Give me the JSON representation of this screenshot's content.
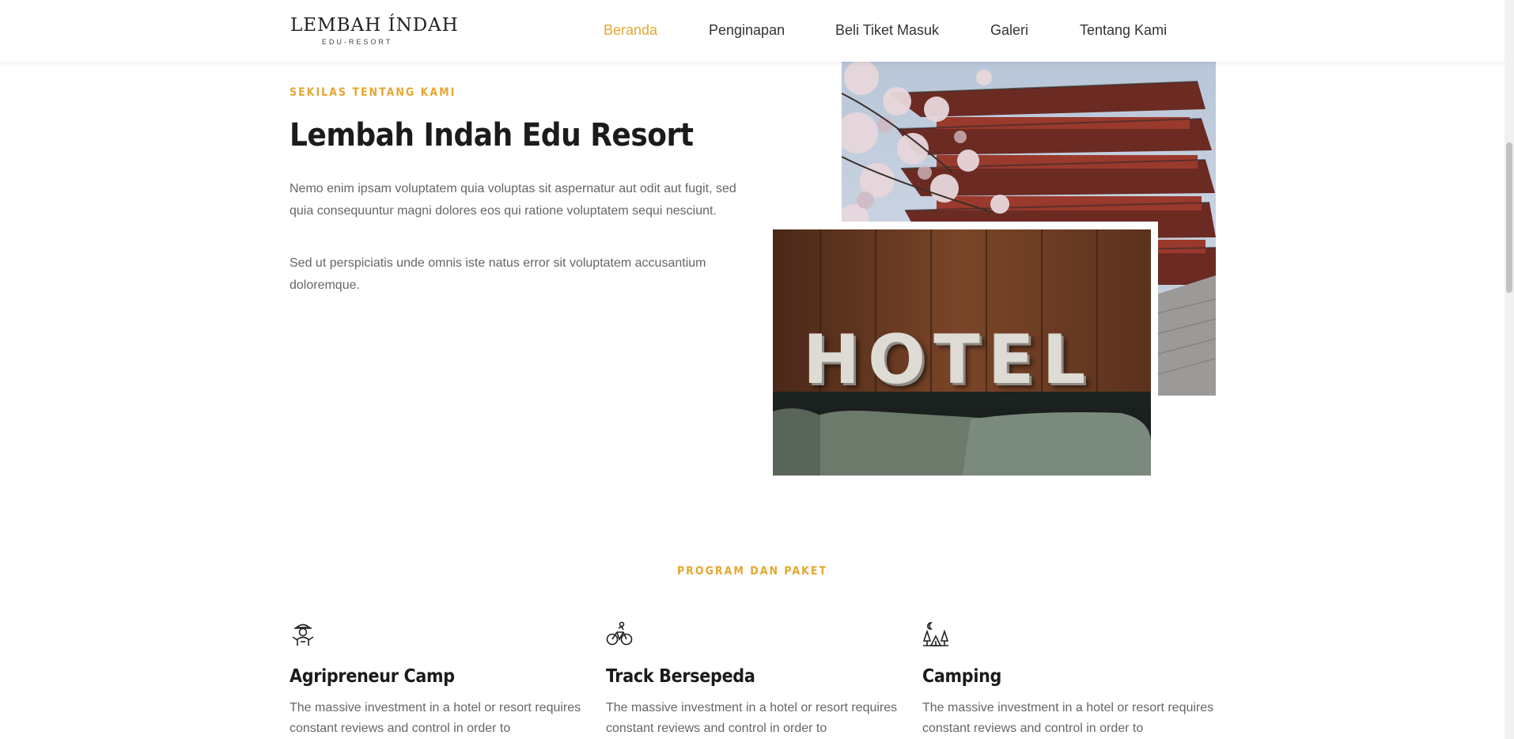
{
  "header": {
    "logo_main": "LEMBAH ÍNDAH",
    "logo_sub": "EDU-RESORT",
    "nav": [
      {
        "label": "Beranda",
        "active": true
      },
      {
        "label": "Penginapan",
        "active": false
      },
      {
        "label": "Beli Tiket Masuk",
        "active": false
      },
      {
        "label": "Galeri",
        "active": false
      },
      {
        "label": "Tentang Kami",
        "active": false
      }
    ]
  },
  "about": {
    "kicker": "SEKILAS TENTANG KAMI",
    "title": "Lembah Indah Edu Resort",
    "paragraphs": [
      "Nemo enim ipsam voluptatem quia voluptas sit aspernatur aut odit aut fugit, sed quia consequuntur magni dolores eos qui ratione voluptatem sequi nesciunt.",
      "Sed ut perspiciatis unde omnis iste natus error sit voluptatem accusantium doloremque."
    ],
    "hotel_sign": "HOTEL"
  },
  "program": {
    "kicker": "PROGRAM DAN PAKET",
    "cards": [
      {
        "icon": "farmer-icon",
        "title": "Agripreneur Camp",
        "text": "The massive investment in a hotel or resort requires constant reviews and control in order to"
      },
      {
        "icon": "bicycle-icon",
        "title": "Track Bersepeda",
        "text": "The massive investment in a hotel or resort requires constant reviews and control in order to"
      },
      {
        "icon": "camping-tent-icon",
        "title": "Camping",
        "text": "The massive investment in a hotel or resort requires constant reviews and control in order to"
      }
    ]
  },
  "colors": {
    "accent": "#e5a72f",
    "heading": "#1b1b1b",
    "body_text": "#666666"
  }
}
